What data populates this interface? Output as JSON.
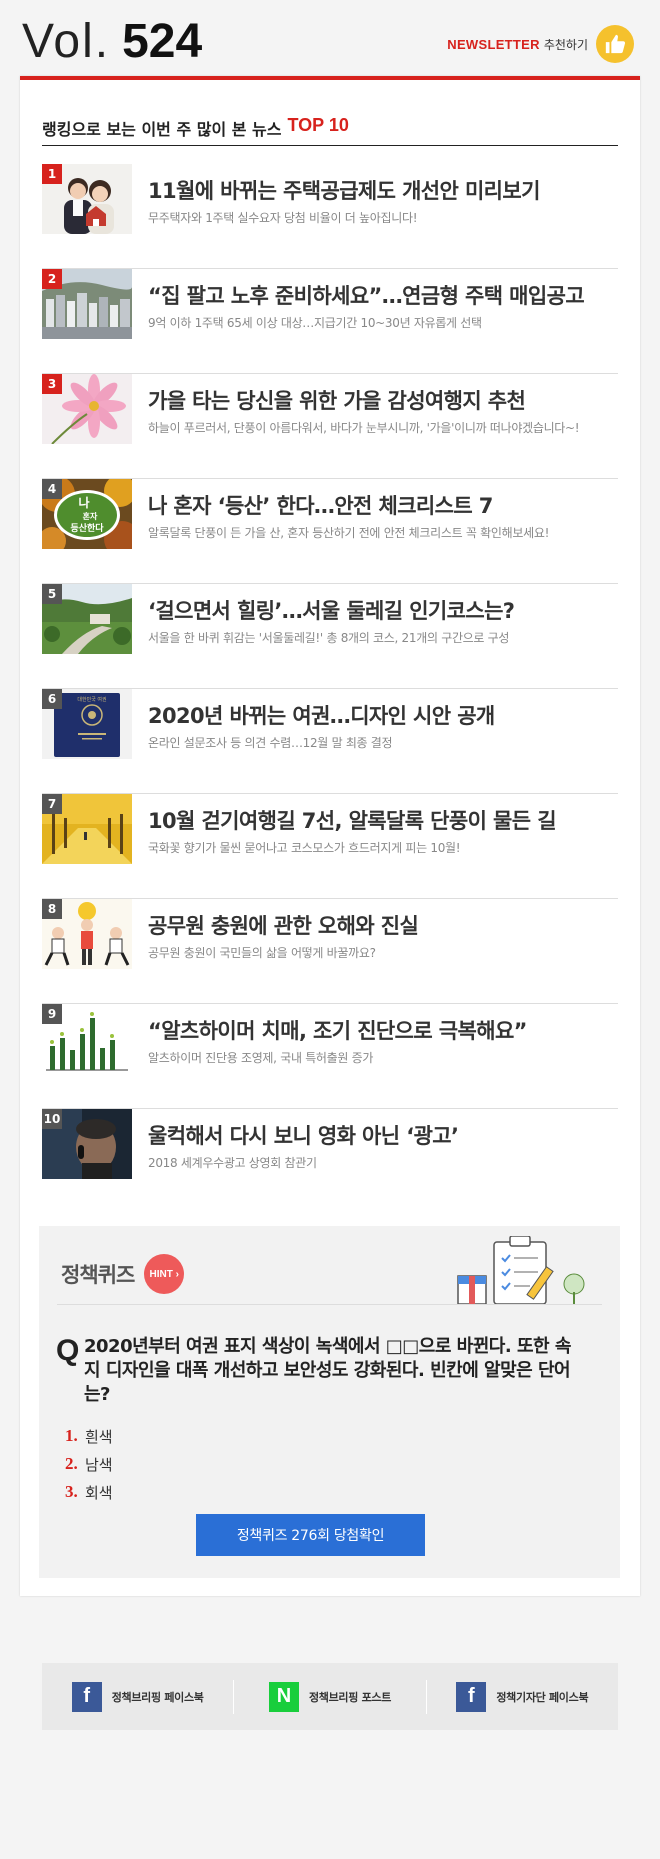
{
  "header": {
    "vol_label": "Vol.",
    "vol_number": "524",
    "newsletter_label": "NEWSLETTER",
    "recommend_label": "추천하기",
    "thumb_icon": "thumbs-up-icon"
  },
  "ranking": {
    "title_prefix": "랭킹으로 보는 이번 주 많이 본 뉴스",
    "title_highlight": "TOP 10",
    "items": [
      {
        "rank": "1",
        "title": "11월에 바뀌는 주택공급제도 개선안 미리보기",
        "subtitle": "무주택자와 1주택 실수요자 당첨 비율이 더 높아집니다!"
      },
      {
        "rank": "2",
        "title": "“집 팔고 노후 준비하세요”…연금형 주택 매입공고",
        "subtitle": "9억 이하 1주택 65세 이상 대상…지급기간 10~30년 자유롭게 선택"
      },
      {
        "rank": "3",
        "title": "가을 타는 당신을 위한 가을 감성여행지 추천",
        "subtitle": "하늘이 푸르러서, 단풍이 아름다워서, 바다가 눈부시니까, '가을'이니까 떠나야겠습니다~!"
      },
      {
        "rank": "4",
        "title": "나 혼자 ‘등산’ 한다…안전 체크리스트 7",
        "subtitle": "알록달록 단풍이 든 가을 산, 혼자 등산하기 전에 안전 체크리스트 꼭 확인해보세요!",
        "badge": [
          "나",
          "혼자",
          "등산한다"
        ]
      },
      {
        "rank": "5",
        "title": "‘걸으면서 힐링’…서울 둘레길 인기코스는?",
        "subtitle": "서울을 한 바퀴 휘감는 '서울둘레길!' 총 8개의 코스, 21개의 구간으로 구성"
      },
      {
        "rank": "6",
        "title": "2020년 바뀌는 여권…디자인 시안 공개",
        "subtitle": "온라인 설문조사 등 의견 수렴…12월 말 최종 결정",
        "passport_text": "대한민국 여권"
      },
      {
        "rank": "7",
        "title": "10월 걷기여행길 7선, 알록달록 단풍이 물든 길",
        "subtitle": "국화꽃 향기가 물씬 묻어나고 코스모스가 흐드러지게 피는 10월!"
      },
      {
        "rank": "8",
        "title": "공무원 충원에 관한 오해와 진실",
        "subtitle": "공무원 충원이 국민들의 삶을 어떻게 바꿀까요?"
      },
      {
        "rank": "9",
        "title": "“알츠하이머 치매, 조기 진단으로 극복해요”",
        "subtitle": "알츠하이머 진단용 조영제, 국내 특허출원 증가"
      },
      {
        "rank": "10",
        "title": "울컥해서 다시 보니 영화 아닌 ‘광고’",
        "subtitle": "2018 세계우수광고 상영회 참관기"
      }
    ]
  },
  "quiz": {
    "title": "정책퀴즈",
    "hint_label": "HINT",
    "q_mark": "Q",
    "question": "2020년부터 여권 표지 색상이 녹색에서 □□으로 바뀐다. 또한 속지 디자인을 대폭 개선하고 보안성도 강화된다. 빈칸에 알맞은 단어는?",
    "options": [
      {
        "num": "1.",
        "text": "흰색"
      },
      {
        "num": "2.",
        "text": "남색"
      },
      {
        "num": "3.",
        "text": "회색"
      }
    ],
    "button_label": "정책퀴즈 276회 당첨확인"
  },
  "footer": {
    "links": [
      {
        "icon": "facebook-icon",
        "glyph": "f",
        "label": "정책브리핑 페이스북"
      },
      {
        "icon": "naver-icon",
        "glyph": "N",
        "label": "정책브리핑 포스트"
      },
      {
        "icon": "facebook-icon",
        "glyph": "f",
        "label": "정책기자단 페이스북"
      }
    ]
  },
  "colors": {
    "accent_red": "#d7221d",
    "button_blue": "#2a6fd6",
    "facebook_blue": "#3b5998",
    "naver_green": "#19ce3c",
    "hint_red": "#ee5a5a"
  }
}
